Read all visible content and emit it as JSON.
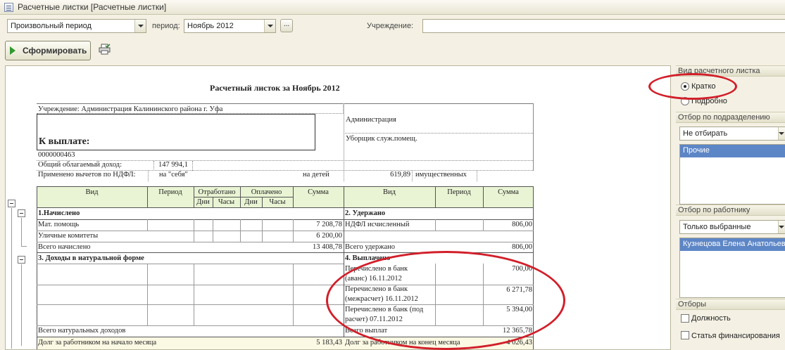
{
  "window": {
    "title": "Расчетные листки [Расчетные листки]"
  },
  "toolbar": {
    "period_type": "Произвольный период",
    "period_label": "период:",
    "period_value": "Ноябрь 2012",
    "dots_label": "...",
    "institution_label": "Учреждение:",
    "generate_label": "Сформировать"
  },
  "report": {
    "title": "Расчетный листок за Ноябрь 2012",
    "institution_line": "Учреждение: Администрация Калининского района г. Уфа",
    "department": "Администрация",
    "position": "Уборщик служ.помещ.",
    "to_pay_label": "К выплате:",
    "personnel_number": "0000000463",
    "taxable_income_label": "Общий облагаемый доход:",
    "taxable_income_value": "147 994,1",
    "deductions_label": "Применено вычетов по НДФЛ:",
    "deduction_self": "на \"себя\"",
    "deduction_children_label": "на детей",
    "deduction_children_value": "619,89",
    "deduction_property": "имущественных",
    "headers": {
      "vid": "Вид",
      "period": "Период",
      "worked": "Отработано",
      "paid": "Оплачено",
      "days": "Дни",
      "hours": "Часы",
      "sum": "Сумма"
    },
    "accrued": {
      "title": "1.Начислено",
      "rows": [
        {
          "name": "Мат. помощь",
          "sum": "7 208,78"
        },
        {
          "name": "Уличные комитеты",
          "sum": "6 200,00"
        }
      ],
      "total_label": "Всего начислено",
      "total": "13 408,78"
    },
    "withheld": {
      "title": "2. Удержано",
      "rows": [
        {
          "name": "НДФЛ исчисленный",
          "sum": "806,00"
        }
      ],
      "total_label": "Всего удержано",
      "total": "806,00"
    },
    "natural": {
      "title": "3. Доходы в натуральной форме",
      "total_label": "Всего натуральных доходов"
    },
    "payments": {
      "title": "4. Выплачено",
      "rows": [
        {
          "line1": "Перечислено в банк",
          "line2": "(аванс) 16.11.2012",
          "sum": "700,00"
        },
        {
          "line1": "Перечислено в банк",
          "line2": "(межрасчет) 16.11.2012",
          "sum": "6 271,78"
        },
        {
          "line1": "Перечислено в банк (под",
          "line2": "расчет) 07.11.2012",
          "sum": "5 394,00"
        }
      ],
      "total_label": "Всего выплат",
      "total": "12 365,78"
    },
    "debt_start_label": "Долг за работником на начало месяца",
    "debt_start_value": "5 183,43",
    "debt_end_label": "Долг за работником на конец месяца",
    "debt_end_value": "4 026,43"
  },
  "panel": {
    "sheet_type_title": "Вид расчетного листка",
    "opt_short": "Кратко",
    "opt_detail": "Подробно",
    "dept_filter_title": "Отбор по подразделению",
    "dept_filter_value": "Не отбирать",
    "dept_list_selected": "Прочие",
    "emp_filter_title": "Отбор по работнику",
    "emp_filter_value": "Только выбранные",
    "emp_list_selected": "Кузнецова Елена Анатольевна",
    "filters_title": "Отборы",
    "chk_position": "Должность",
    "chk_finance": "Статья финансирования"
  },
  "colors": {
    "annotation": "#d21f2a",
    "selection": "#5d86c6",
    "table_header": "#e9f4d4"
  }
}
